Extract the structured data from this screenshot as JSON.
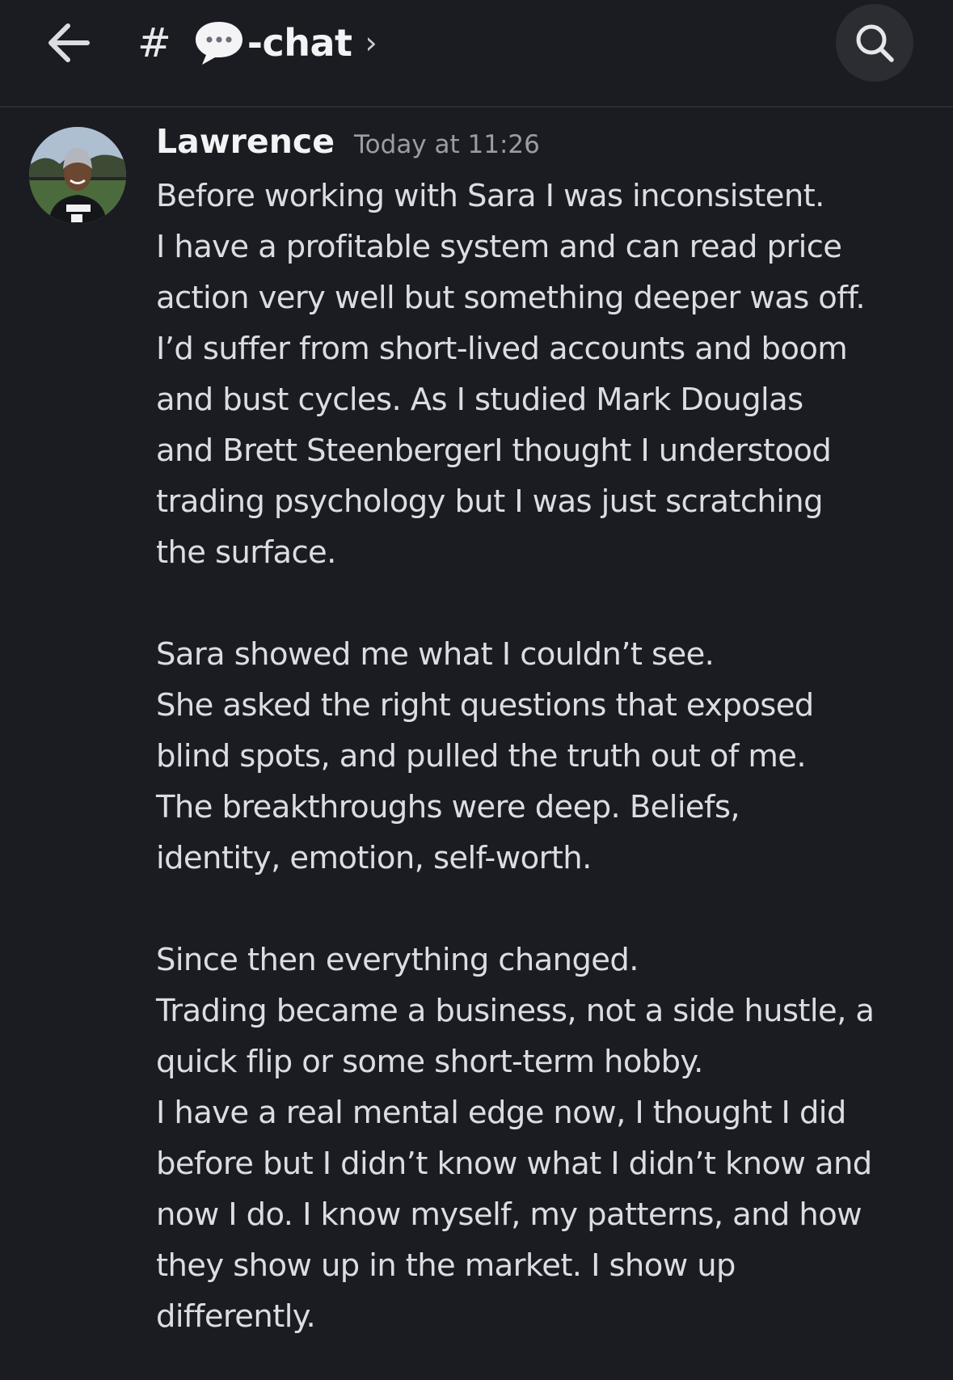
{
  "header": {
    "hash_symbol": "#",
    "channel_icon": "speech-bubble-emoji",
    "channel_name": "-chat",
    "chevron": "›",
    "back_icon": "arrow-left-icon",
    "search_icon": "search-icon"
  },
  "message": {
    "author": "Lawrence",
    "timestamp": "Today at 11:26",
    "paragraphs": [
      [
        "Before working with Sara I was inconsistent.",
        "I have a profitable system and can read price",
        "action very well but something deeper was off.",
        "I’d suffer from short-lived accounts and boom",
        "and bust cycles. As I studied Mark Douglas",
        "and Brett SteenbergerI thought I understood",
        "trading psychology but I was just scratching",
        "the surface."
      ],
      [
        "Sara showed me what I couldn’t see.",
        "She asked the right questions that exposed",
        "blind spots, and pulled the truth out of me.",
        "The breakthroughs were deep. Beliefs,",
        "identity, emotion, self-worth."
      ],
      [
        "Since then everything changed.",
        "Trading became a business, not a side hustle, a",
        "quick flip or some short-term hobby.",
        "I have a real mental edge now, I thought I did",
        "before but I didn’t know what I didn’t know and",
        "now I do. I know myself, my patterns, and how",
        "they show up in the market. I show up",
        "differently."
      ]
    ]
  },
  "colors": {
    "background": "#1b1c22",
    "text": "#dcdde2",
    "muted": "#9a9ca6",
    "search_bg": "#2c2d33"
  }
}
